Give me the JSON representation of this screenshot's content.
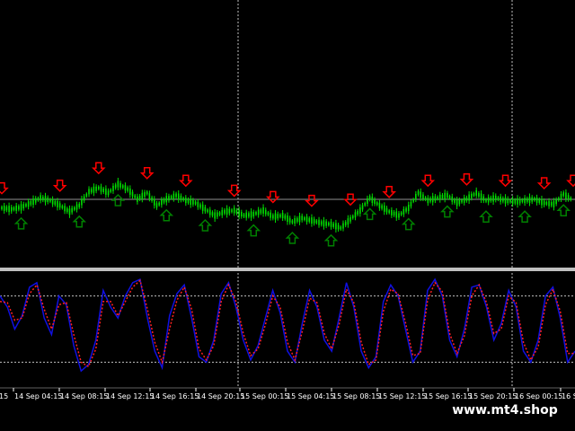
{
  "watermark": "www.mt4.shop",
  "colors": {
    "background": "#000000",
    "candle": "#00e000",
    "arrow_up": "#008000",
    "arrow_down": "#ff0000",
    "stoch_main": "#1010e0",
    "stoch_signal": "#ff2020",
    "grid": "#c0c0c0",
    "separator": "#c0c0c0",
    "text": "#ffffff"
  },
  "chart_data": [
    {
      "type": "candlestick",
      "panel": "price",
      "x_tick_labels": [
        "15",
        "14 Sep 04:15",
        "14 Sep 08:15",
        "14 Sep 12:15",
        "14 Sep 16:15",
        "14 Sep 20:15",
        "15 Sep 00:15",
        "15 Sep 04:15",
        "15 Sep 08:15",
        "15 Sep 12:15",
        "15 Sep 16:15",
        "15 Sep 20:15",
        "16 Sep 00:15",
        "16 Se"
      ],
      "grid": true,
      "series": [
        {
          "name": "",
          "values": [
            0.62,
            0.6,
            0.63,
            0.7,
            0.78,
            0.74,
            0.66,
            0.56,
            0.66,
            0.88,
            0.94,
            0.86,
            1.0,
            0.92,
            0.76,
            0.86,
            0.66,
            0.76,
            0.82,
            0.74,
            0.7,
            0.6,
            0.5,
            0.56,
            0.58,
            0.5,
            0.52,
            0.58,
            0.48,
            0.5,
            0.4,
            0.46,
            0.42,
            0.38,
            0.36,
            0.3,
            0.44,
            0.58,
            0.78,
            0.66,
            0.56,
            0.5,
            0.62,
            0.86,
            0.74,
            0.78,
            0.82,
            0.7,
            0.76,
            0.86,
            0.74,
            0.78,
            0.74,
            0.72,
            0.74,
            0.76,
            0.7,
            0.68,
            0.84,
            0.74
          ]
        }
      ],
      "signals": {
        "down_arrow_index": [
          0,
          6,
          10,
          15,
          19,
          24,
          28,
          32,
          36,
          40,
          44,
          48,
          52,
          56,
          60
        ],
        "up_arrow_index": [
          2,
          8,
          12,
          17,
          21,
          26,
          30,
          34,
          38,
          42,
          46,
          50,
          54,
          58
        ]
      }
    },
    {
      "type": "line",
      "panel": "stochastic",
      "ylim": [
        0,
        100
      ],
      "levels": [
        80,
        20
      ],
      "series": [
        {
          "name": "",
          "values": [
            80,
            70,
            50,
            62,
            88,
            92,
            60,
            45,
            80,
            72,
            35,
            12,
            18,
            40,
            85,
            70,
            60,
            80,
            92,
            95,
            60,
            30,
            15,
            62,
            82,
            90,
            60,
            25,
            20,
            40,
            82,
            92,
            70,
            40,
            22,
            35,
            60,
            85,
            65,
            30,
            20,
            55,
            85,
            70,
            40,
            30,
            60,
            92,
            70,
            30,
            15,
            25,
            75,
            90,
            80,
            50,
            20,
            30,
            85,
            95,
            80,
            40,
            25,
            50,
            88,
            90,
            70,
            40,
            55,
            85,
            70,
            30,
            20,
            40,
            80,
            88,
            60,
            20,
            30
          ]
        },
        {
          "name": "",
          "values": [
            75,
            74,
            58,
            60,
            82,
            90,
            68,
            50,
            72,
            74,
            45,
            20,
            16,
            32,
            75,
            75,
            62,
            75,
            88,
            94,
            68,
            38,
            20,
            50,
            76,
            88,
            68,
            32,
            22,
            35,
            75,
            90,
            75,
            46,
            26,
            32,
            54,
            80,
            70,
            38,
            22,
            48,
            78,
            74,
            46,
            32,
            54,
            86,
            74,
            38,
            18,
            22,
            66,
            86,
            82,
            56,
            26,
            28,
            76,
            92,
            84,
            46,
            28,
            44,
            80,
            90,
            74,
            46,
            50,
            80,
            74,
            38,
            22,
            34,
            72,
            86,
            66,
            28,
            28
          ]
        }
      ]
    }
  ]
}
